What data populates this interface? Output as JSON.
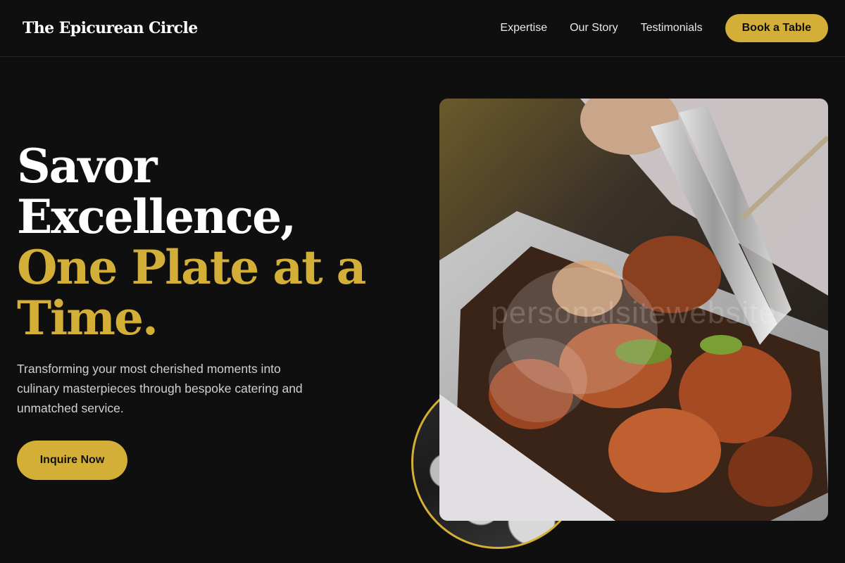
{
  "nav": {
    "brand": "The Epicurean Circle",
    "links": [
      "Expertise",
      "Our Story",
      "Testimonials"
    ],
    "cta_label": "Book a Table"
  },
  "hero": {
    "title_lines_white": [
      "Savor",
      "Excellence,"
    ],
    "title_lines_gold": [
      "One Plate at a",
      "Time."
    ],
    "subtitle": "Transforming your most cherished moments into culinary masterpieces through bespoke catering and unmatched service.",
    "cta_label": "Inquire Now"
  },
  "images": {
    "main_photo_watermark": "personalsitewebsite"
  },
  "colors": {
    "accent": "#d4af37",
    "background": "#0f0f0f",
    "text_primary": "#ffffff",
    "text_secondary": "#d0d0d0"
  }
}
